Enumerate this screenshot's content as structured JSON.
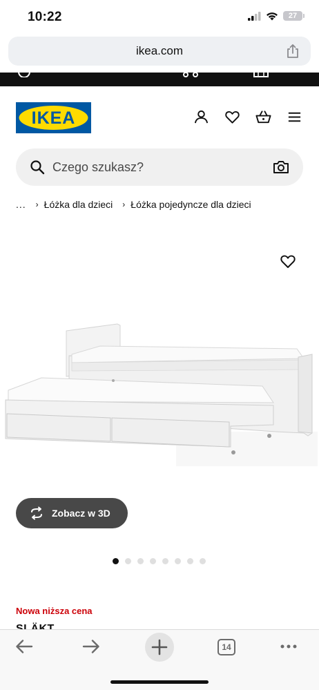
{
  "status_bar": {
    "time": "10:22",
    "battery": "27"
  },
  "browser": {
    "url": "ikea.com",
    "tab_count": "14"
  },
  "header": {
    "logo_text": "IKEA",
    "brand_blue": "#0058a3",
    "brand_yellow": "#ffdb00",
    "icons": [
      "user-icon",
      "heart-icon",
      "basket-icon",
      "menu-icon"
    ]
  },
  "search": {
    "placeholder": "Czego szukasz?"
  },
  "breadcrumb": {
    "items": [
      "...",
      "Łóżka dla dzieci",
      "Łóżka pojedyncze dla dzieci"
    ]
  },
  "product": {
    "view_3d_label": "Zobacz w 3D",
    "image_count": 8,
    "active_image_index": 0,
    "price_tag": "Nowa niższa cena",
    "name": "SLÄKT",
    "price_tag_color": "#cc0008"
  }
}
